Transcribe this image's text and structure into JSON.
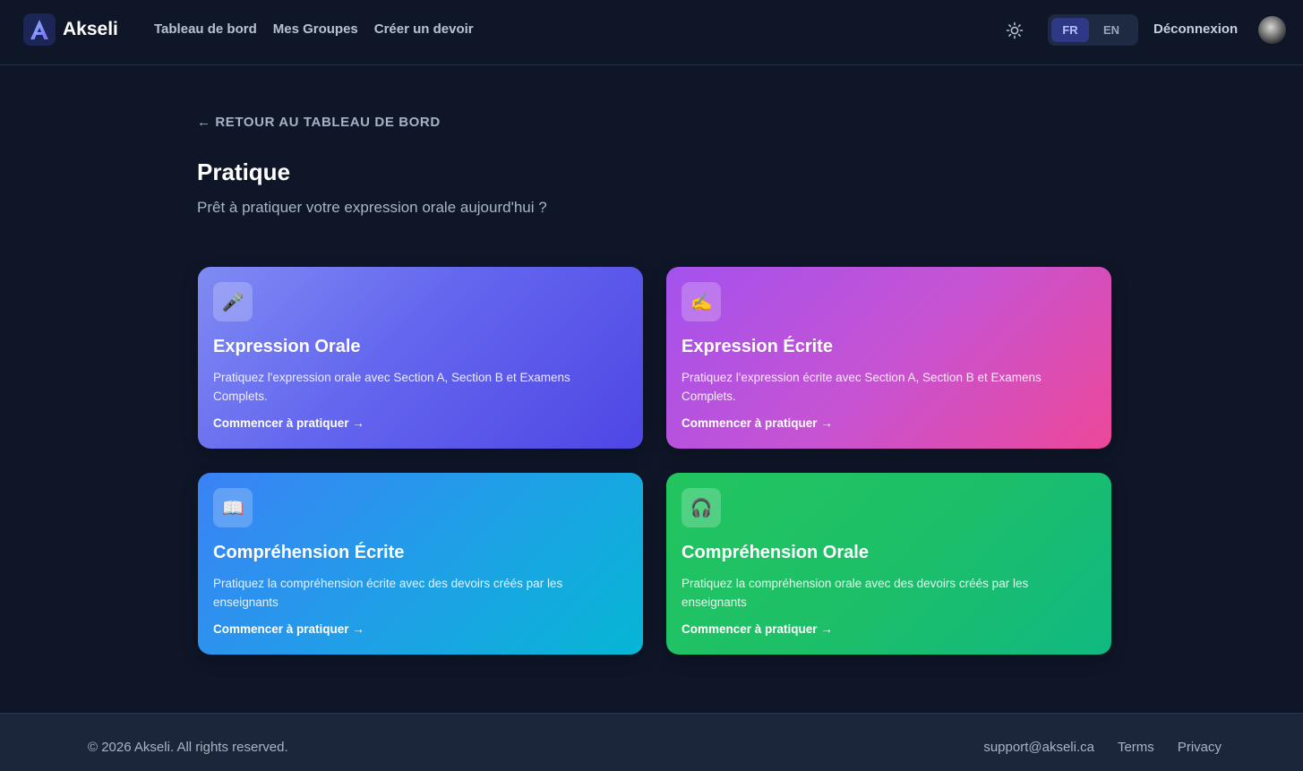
{
  "header": {
    "brand": "Akseli",
    "logo_letter": "A",
    "nav": [
      "Tableau de bord",
      "Mes Groupes",
      "Créer un devoir"
    ],
    "theme_icon": "sun-icon",
    "languages": [
      {
        "label": "FR",
        "active": true
      },
      {
        "label": "EN",
        "active": false
      }
    ],
    "logout": "Déconnexion"
  },
  "main": {
    "back_link": "← RETOUR AU TABLEAU DE BORD",
    "title": "Pratique",
    "subtitle": "Prêt à pratiquer votre expression orale aujourd'hui ?",
    "cards": [
      {
        "icon": "🎤",
        "icon_name": "microphone-icon",
        "title": "Expression Orale",
        "description": "Pratiquez l'expression orale avec Section A, Section B et Examens Complets.",
        "cta": "Commencer à pratiquer →"
      },
      {
        "icon": "✍️",
        "icon_name": "writing-hand-icon",
        "title": "Expression Écrite",
        "description": "Pratiquez l'expression écrite avec Section A, Section B et Examens Complets.",
        "cta": "Commencer à pratiquer →"
      },
      {
        "icon": "📖",
        "icon_name": "open-book-icon",
        "title": "Compréhension Écrite",
        "description": "Pratiquez la compréhension écrite avec des devoirs créés par les enseignants",
        "cta": "Commencer à pratiquer →"
      },
      {
        "icon": "🎧",
        "icon_name": "headphones-icon",
        "title": "Compréhension Orale",
        "description": "Pratiquez la compréhension orale avec des devoirs créés par les enseignants",
        "cta": "Commencer à pratiquer →"
      }
    ]
  },
  "footer": {
    "copyright": "© 2026 Akseli. All rights reserved.",
    "links": [
      "support@akseli.ca",
      "Terms",
      "Privacy"
    ]
  },
  "colors": {
    "background": "#0e1628",
    "footer": "#1b263b",
    "accent": "#4f46e5"
  }
}
